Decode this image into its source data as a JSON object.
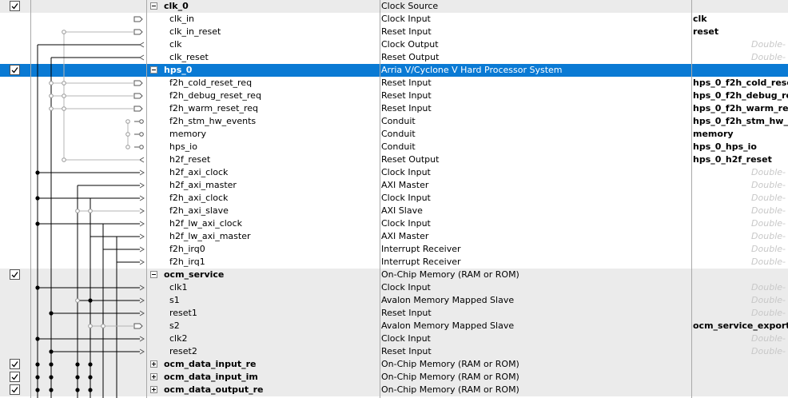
{
  "columns_hint": "Double-click to export",
  "rows": [
    {
      "kind": "group",
      "name": "clk_0",
      "desc": "Clock Source",
      "export": "",
      "checked": true,
      "expanded": true
    },
    {
      "kind": "child",
      "name": "clk_in",
      "desc": "Clock Input",
      "export": "clk"
    },
    {
      "kind": "child",
      "name": "clk_in_reset",
      "desc": "Reset Input",
      "export": "reset"
    },
    {
      "kind": "child",
      "name": "clk",
      "desc": "Clock Output",
      "export": "Double-"
    },
    {
      "kind": "child",
      "name": "clk_reset",
      "desc": "Reset Output",
      "export": "Double-"
    },
    {
      "kind": "group",
      "name": "hps_0",
      "desc": "Arria V/Cyclone V Hard Processor System",
      "export": "",
      "checked": true,
      "expanded": true,
      "selected": true
    },
    {
      "kind": "child",
      "name": "f2h_cold_reset_req",
      "desc": "Reset Input",
      "export": "hps_0_f2h_cold_rese"
    },
    {
      "kind": "child",
      "name": "f2h_debug_reset_req",
      "desc": "Reset Input",
      "export": "hps_0_f2h_debug_re"
    },
    {
      "kind": "child",
      "name": "f2h_warm_reset_req",
      "desc": "Reset Input",
      "export": "hps_0_f2h_warm_re"
    },
    {
      "kind": "child",
      "name": "f2h_stm_hw_events",
      "desc": "Conduit",
      "export": "hps_0_f2h_stm_hw_"
    },
    {
      "kind": "child",
      "name": "memory",
      "desc": "Conduit",
      "export": "memory"
    },
    {
      "kind": "child",
      "name": "hps_io",
      "desc": "Conduit",
      "export": "hps_0_hps_io"
    },
    {
      "kind": "child",
      "name": "h2f_reset",
      "desc": "Reset Output",
      "export": "hps_0_h2f_reset"
    },
    {
      "kind": "child",
      "name": "h2f_axi_clock",
      "desc": "Clock Input",
      "export": "Double-"
    },
    {
      "kind": "child",
      "name": "h2f_axi_master",
      "desc": "AXI Master",
      "export": "Double-"
    },
    {
      "kind": "child",
      "name": "f2h_axi_clock",
      "desc": "Clock Input",
      "export": "Double-"
    },
    {
      "kind": "child",
      "name": "f2h_axi_slave",
      "desc": "AXI Slave",
      "export": "Double-"
    },
    {
      "kind": "child",
      "name": "h2f_lw_axi_clock",
      "desc": "Clock Input",
      "export": "Double-"
    },
    {
      "kind": "child",
      "name": "h2f_lw_axi_master",
      "desc": "AXI Master",
      "export": "Double-"
    },
    {
      "kind": "child",
      "name": "f2h_irq0",
      "desc": "Interrupt Receiver",
      "export": "Double-"
    },
    {
      "kind": "child",
      "name": "f2h_irq1",
      "desc": "Interrupt Receiver",
      "export": "Double-"
    },
    {
      "kind": "group",
      "name": "ocm_service",
      "desc": "On-Chip Memory (RAM or ROM)",
      "export": "",
      "checked": true,
      "expanded": true
    },
    {
      "kind": "child",
      "name": "clk1",
      "desc": "Clock Input",
      "export": "Double-",
      "shaded": true
    },
    {
      "kind": "child",
      "name": "s1",
      "desc": "Avalon Memory Mapped Slave",
      "export": "Double-",
      "shaded": true
    },
    {
      "kind": "child",
      "name": "reset1",
      "desc": "Reset Input",
      "export": "Double-",
      "shaded": true
    },
    {
      "kind": "child",
      "name": "s2",
      "desc": "Avalon Memory Mapped Slave",
      "export": "ocm_service_export",
      "shaded": true
    },
    {
      "kind": "child",
      "name": "clk2",
      "desc": "Clock Input",
      "export": "Double-",
      "shaded": true
    },
    {
      "kind": "child",
      "name": "reset2",
      "desc": "Reset Input",
      "export": "Double-",
      "shaded": true
    },
    {
      "kind": "group",
      "name": "ocm_data_input_re",
      "desc": "On-Chip Memory (RAM or ROM)",
      "export": "",
      "checked": true,
      "expanded": false
    },
    {
      "kind": "group",
      "name": "ocm_data_input_im",
      "desc": "On-Chip Memory (RAM or ROM)",
      "export": "",
      "checked": true,
      "expanded": false
    },
    {
      "kind": "group",
      "name": "ocm_data_output_re",
      "desc": "On-Chip Memory (RAM or ROM)",
      "export": "",
      "checked": true,
      "expanded": false
    }
  ]
}
